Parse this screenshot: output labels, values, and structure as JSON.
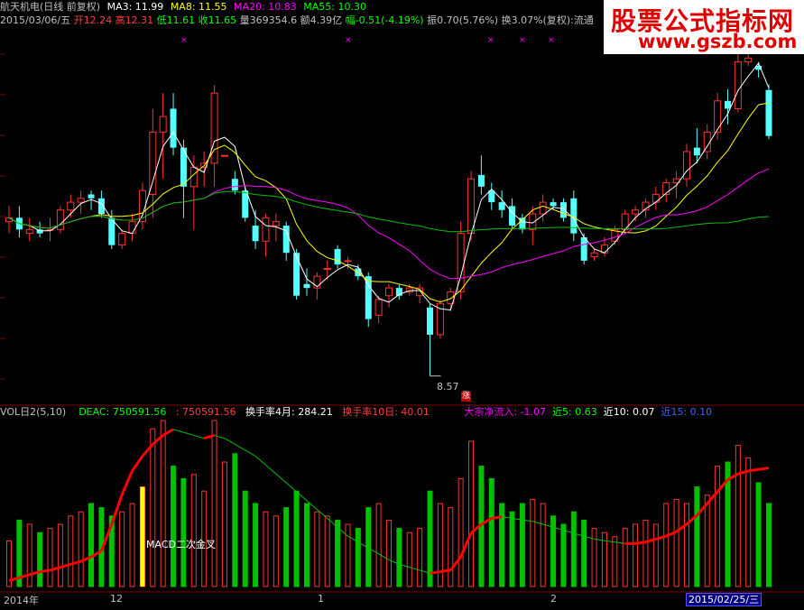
{
  "header": {
    "stock_name": "航天机电(日线 前复权)",
    "ma3": "MA3: 11.99",
    "ma8": "MA8: 11.55",
    "ma20": "MA20: 10.83",
    "ma55": "MA55: 10.30",
    "date": "2015/03/06/五",
    "open": "开12.24",
    "high": "高12.31",
    "low": "低11.61",
    "close": "收11.65",
    "volume": "量369354.6",
    "amount": "额4.39亿",
    "change": "幅-0.51(-4.19%)",
    "amplitude": "振0.70(5.76%)",
    "turnover": "换3.07%(复权):流通",
    "colors": {
      "ma3": "#ffffff",
      "ma8": "#ffff00",
      "ma20": "#ff00ff",
      "ma55": "#00ff00",
      "up": "#ff3232",
      "down": "#54ffff"
    }
  },
  "watermark": {
    "line1": "股票公式指标网",
    "line2": "www.gszb.com"
  },
  "volume_header": {
    "title": "VOL日2(5,10)",
    "deac": "DEAC: 750591.56",
    "deac2": ": 750591.56",
    "turn4": "换手率4月: 284.21",
    "turn10": "换手率10日: 40.01",
    "block_inflow": "大宗净流入: -1.07",
    "near5": "近5: 0.63",
    "near10": "近10: 0.07",
    "near15": "近15: 0.10"
  },
  "annotations": {
    "macd_cross": "MACD二次金叉",
    "low_price": "8.57",
    "zhang": "涨"
  },
  "date_axis": {
    "labels": [
      "2014年",
      "12",
      "1",
      "2"
    ],
    "cursor_date": "2015/02/25/三"
  },
  "chart_data": {
    "type": "candlestick",
    "title": "航天机电(日线 前复权)",
    "price_range": [
      8.3,
      12.7
    ],
    "candles": [
      {
        "o": 10.55,
        "h": 10.75,
        "l": 10.4,
        "c": 10.6
      },
      {
        "o": 10.6,
        "h": 10.75,
        "l": 10.35,
        "c": 10.45
      },
      {
        "o": 10.4,
        "h": 10.6,
        "l": 10.3,
        "c": 10.45
      },
      {
        "o": 10.45,
        "h": 10.55,
        "l": 10.35,
        "c": 10.4
      },
      {
        "o": 10.45,
        "h": 10.6,
        "l": 10.3,
        "c": 10.45
      },
      {
        "o": 10.45,
        "h": 10.75,
        "l": 10.4,
        "c": 10.7
      },
      {
        "o": 10.7,
        "h": 10.9,
        "l": 10.6,
        "c": 10.8
      },
      {
        "o": 10.8,
        "h": 10.95,
        "l": 10.65,
        "c": 10.85
      },
      {
        "o": 10.9,
        "h": 10.95,
        "l": 10.7,
        "c": 10.85
      },
      {
        "o": 10.85,
        "h": 10.95,
        "l": 10.6,
        "c": 10.65
      },
      {
        "o": 10.6,
        "h": 10.7,
        "l": 10.2,
        "c": 10.25
      },
      {
        "o": 10.25,
        "h": 10.45,
        "l": 10.2,
        "c": 10.4
      },
      {
        "o": 10.4,
        "h": 10.65,
        "l": 10.3,
        "c": 10.55
      },
      {
        "o": 10.55,
        "h": 11.05,
        "l": 10.45,
        "c": 10.95
      },
      {
        "o": 10.9,
        "h": 12.0,
        "l": 10.6,
        "c": 11.7
      },
      {
        "o": 11.7,
        "h": 12.2,
        "l": 11.1,
        "c": 11.9
      },
      {
        "o": 12.0,
        "h": 12.2,
        "l": 11.4,
        "c": 11.5
      },
      {
        "o": 11.5,
        "h": 11.6,
        "l": 10.6,
        "c": 11.0
      },
      {
        "o": 11.0,
        "h": 11.4,
        "l": 10.45,
        "c": 11.25
      },
      {
        "o": 11.25,
        "h": 11.45,
        "l": 11.0,
        "c": 11.3
      },
      {
        "o": 11.3,
        "h": 12.3,
        "l": 11.0,
        "c": 12.2
      },
      {
        "o": 11.4,
        "h": 11.4,
        "l": 11.39,
        "c": 11.4
      },
      {
        "o": 11.1,
        "h": 11.2,
        "l": 10.9,
        "c": 10.95
      },
      {
        "o": 10.95,
        "h": 11.0,
        "l": 10.55,
        "c": 10.6
      },
      {
        "o": 10.5,
        "h": 10.7,
        "l": 10.2,
        "c": 10.3
      },
      {
        "o": 10.3,
        "h": 10.65,
        "l": 10.1,
        "c": 10.6
      },
      {
        "o": 10.5,
        "h": 10.65,
        "l": 10.3,
        "c": 10.55
      },
      {
        "o": 10.5,
        "h": 10.55,
        "l": 10.05,
        "c": 10.15
      },
      {
        "o": 10.15,
        "h": 10.2,
        "l": 9.55,
        "c": 9.6
      },
      {
        "o": 9.75,
        "h": 9.95,
        "l": 9.6,
        "c": 9.7
      },
      {
        "o": 9.7,
        "h": 9.9,
        "l": 9.55,
        "c": 9.85
      },
      {
        "o": 9.95,
        "h": 10.05,
        "l": 9.8,
        "c": 9.95
      },
      {
        "o": 10.2,
        "h": 10.25,
        "l": 9.95,
        "c": 10.0
      },
      {
        "o": 10.05,
        "h": 10.1,
        "l": 9.95,
        "c": 10.05
      },
      {
        "o": 9.95,
        "h": 10.0,
        "l": 9.8,
        "c": 9.85
      },
      {
        "o": 9.85,
        "h": 9.9,
        "l": 9.2,
        "c": 9.3
      },
      {
        "o": 9.35,
        "h": 9.6,
        "l": 9.25,
        "c": 9.55
      },
      {
        "o": 9.6,
        "h": 9.75,
        "l": 9.45,
        "c": 9.7
      },
      {
        "o": 9.7,
        "h": 9.75,
        "l": 9.55,
        "c": 9.6
      },
      {
        "o": 9.65,
        "h": 9.75,
        "l": 9.6,
        "c": 9.7
      },
      {
        "o": 9.6,
        "h": 9.75,
        "l": 9.5,
        "c": 9.7
      },
      {
        "o": 9.45,
        "h": 9.5,
        "l": 8.57,
        "c": 9.1
      },
      {
        "o": 9.1,
        "h": 9.55,
        "l": 9.05,
        "c": 9.5
      },
      {
        "o": 9.5,
        "h": 9.7,
        "l": 9.4,
        "c": 9.65
      },
      {
        "o": 9.65,
        "h": 10.55,
        "l": 9.55,
        "c": 10.4
      },
      {
        "o": 10.4,
        "h": 11.2,
        "l": 10.3,
        "c": 11.1
      },
      {
        "o": 11.15,
        "h": 11.4,
        "l": 10.9,
        "c": 11.0
      },
      {
        "o": 10.95,
        "h": 11.05,
        "l": 10.7,
        "c": 10.8
      },
      {
        "o": 10.8,
        "h": 10.95,
        "l": 10.6,
        "c": 10.7
      },
      {
        "o": 10.75,
        "h": 10.85,
        "l": 10.45,
        "c": 10.5
      },
      {
        "o": 10.6,
        "h": 10.65,
        "l": 10.4,
        "c": 10.45
      },
      {
        "o": 10.45,
        "h": 10.75,
        "l": 10.25,
        "c": 10.65
      },
      {
        "o": 10.65,
        "h": 10.9,
        "l": 10.55,
        "c": 10.8
      },
      {
        "o": 10.8,
        "h": 10.85,
        "l": 10.7,
        "c": 10.75
      },
      {
        "o": 10.8,
        "h": 10.85,
        "l": 10.55,
        "c": 10.6
      },
      {
        "o": 10.85,
        "h": 10.95,
        "l": 10.3,
        "c": 10.4
      },
      {
        "o": 10.35,
        "h": 10.4,
        "l": 10.0,
        "c": 10.05
      },
      {
        "o": 10.1,
        "h": 10.2,
        "l": 10.05,
        "c": 10.15
      },
      {
        "o": 10.15,
        "h": 10.35,
        "l": 10.1,
        "c": 10.25
      },
      {
        "o": 10.3,
        "h": 10.5,
        "l": 10.25,
        "c": 10.45
      },
      {
        "o": 10.45,
        "h": 10.7,
        "l": 10.4,
        "c": 10.65
      },
      {
        "o": 10.65,
        "h": 10.75,
        "l": 10.55,
        "c": 10.7
      },
      {
        "o": 10.7,
        "h": 10.85,
        "l": 10.6,
        "c": 10.8
      },
      {
        "o": 10.8,
        "h": 11.0,
        "l": 10.7,
        "c": 10.9
      },
      {
        "o": 10.9,
        "h": 11.1,
        "l": 10.8,
        "c": 11.05
      },
      {
        "o": 11.05,
        "h": 11.2,
        "l": 10.85,
        "c": 11.1
      },
      {
        "o": 11.1,
        "h": 11.55,
        "l": 11.0,
        "c": 11.45
      },
      {
        "o": 11.5,
        "h": 11.75,
        "l": 11.3,
        "c": 11.4
      },
      {
        "o": 11.45,
        "h": 11.8,
        "l": 11.35,
        "c": 11.7
      },
      {
        "o": 11.7,
        "h": 12.2,
        "l": 11.6,
        "c": 12.1
      },
      {
        "o": 12.1,
        "h": 12.25,
        "l": 11.8,
        "c": 12.0
      },
      {
        "o": 12.0,
        "h": 12.7,
        "l": 11.95,
        "c": 12.6
      },
      {
        "o": 12.6,
        "h": 12.7,
        "l": 12.55,
        "c": 12.65
      },
      {
        "o": 12.55,
        "h": 12.6,
        "l": 12.4,
        "c": 12.5
      },
      {
        "o": 12.24,
        "h": 12.31,
        "l": 11.61,
        "c": 11.65
      }
    ],
    "volume": {
      "range": [
        0,
        400000
      ],
      "values": [
        110000,
        160000,
        150000,
        130000,
        140000,
        150000,
        170000,
        180000,
        200000,
        190000,
        170000,
        180000,
        200000,
        240000,
        380000,
        400000,
        290000,
        260000,
        270000,
        230000,
        400000,
        300000,
        320000,
        230000,
        200000,
        180000,
        170000,
        190000,
        230000,
        200000,
        180000,
        170000,
        160000,
        150000,
        140000,
        190000,
        200000,
        160000,
        140000,
        130000,
        140000,
        230000,
        200000,
        190000,
        260000,
        350000,
        290000,
        260000,
        200000,
        180000,
        200000,
        210000,
        200000,
        170000,
        150000,
        180000,
        160000,
        140000,
        130000,
        120000,
        140000,
        150000,
        160000,
        150000,
        200000,
        210000,
        200000,
        240000,
        220000,
        290000,
        300000,
        340000,
        310000,
        250000,
        200000
      ],
      "deac": [
        -40000,
        -30000,
        -20000,
        -10000,
        -5000,
        5000,
        15000,
        25000,
        40000,
        60000,
        150000,
        250000,
        330000,
        380000,
        420000,
        450000,
        470000,
        460000,
        450000,
        440000,
        450000,
        440000,
        420000,
        400000,
        380000,
        350000,
        320000,
        290000,
        260000,
        230000,
        200000,
        170000,
        140000,
        110000,
        90000,
        70000,
        50000,
        30000,
        15000,
        5000,
        -5000,
        -15000,
        -10000,
        -5000,
        40000,
        120000,
        150000,
        170000,
        175000,
        170000,
        165000,
        160000,
        150000,
        140000,
        130000,
        120000,
        110000,
        100000,
        95000,
        90000,
        85000,
        85000,
        90000,
        100000,
        110000,
        125000,
        150000,
        180000,
        220000,
        260000,
        300000,
        320000,
        330000,
        335000,
        340000
      ]
    }
  }
}
